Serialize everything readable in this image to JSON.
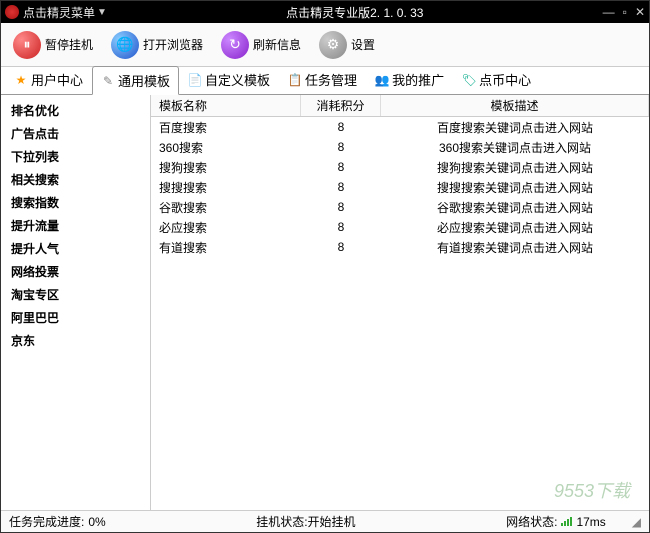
{
  "titlebar": {
    "menu_label": "点击精灵菜单",
    "title": "点击精灵专业版2. 1. 0. 33"
  },
  "toolbar": {
    "pause": "暂停挂机",
    "browser": "打开浏览器",
    "refresh": "刷新信息",
    "settings": "设置"
  },
  "tabs": [
    {
      "label": "用户中心",
      "icon": "star"
    },
    {
      "label": "通用模板",
      "icon": "wand",
      "active": true
    },
    {
      "label": "自定义模板",
      "icon": "doc"
    },
    {
      "label": "任务管理",
      "icon": "task"
    },
    {
      "label": "我的推广",
      "icon": "promo"
    },
    {
      "label": "点币中心",
      "icon": "coin"
    }
  ],
  "sidebar": {
    "items": [
      "排名优化",
      "广告点击",
      "下拉列表",
      "相关搜索",
      "搜索指数",
      "提升流量",
      "提升人气",
      "网络投票",
      "淘宝专区",
      "阿里巴巴",
      "京东"
    ]
  },
  "table": {
    "headers": {
      "name": "模板名称",
      "cost": "消耗积分",
      "desc": "模板描述"
    },
    "rows": [
      {
        "name": "百度搜索",
        "cost": "8",
        "desc": "百度搜索关键词点击进入网站"
      },
      {
        "name": "360搜索",
        "cost": "8",
        "desc": "360搜索关键词点击进入网站"
      },
      {
        "name": "搜狗搜索",
        "cost": "8",
        "desc": "搜狗搜索关键词点击进入网站"
      },
      {
        "name": "搜搜搜索",
        "cost": "8",
        "desc": "搜搜搜索关键词点击进入网站"
      },
      {
        "name": "谷歌搜索",
        "cost": "8",
        "desc": "谷歌搜索关键词点击进入网站"
      },
      {
        "name": "必应搜索",
        "cost": "8",
        "desc": "必应搜索关键词点击进入网站"
      },
      {
        "name": "有道搜索",
        "cost": "8",
        "desc": "有道搜索关键词点击进入网站"
      }
    ]
  },
  "statusbar": {
    "progress_label": "任务完成进度:",
    "progress_value": "0%",
    "status_label": "挂机状态:开始挂机",
    "network_label": "网络状态:",
    "latency": "17ms"
  },
  "watermark": "9553下载"
}
